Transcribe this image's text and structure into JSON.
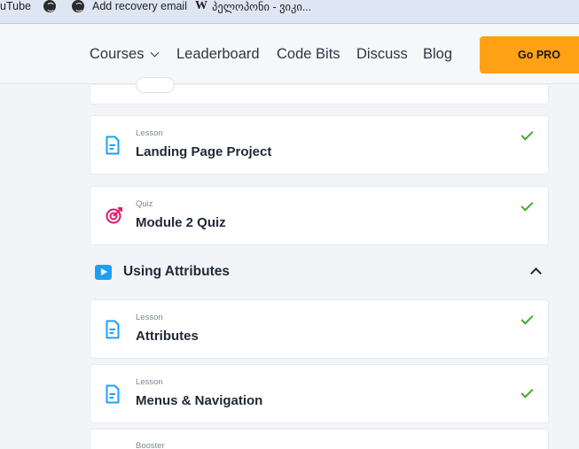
{
  "bookmarks": {
    "items": [
      {
        "label": "uTube"
      },
      {
        "label": ""
      },
      {
        "label": "Add recovery email"
      },
      {
        "label": "პელოპონი - ვიკი..."
      }
    ],
    "wiki_glyph": "W"
  },
  "nav": {
    "courses": "Courses",
    "leaderboard": "Leaderboard",
    "code_bits": "Code Bits",
    "discuss": "Discuss",
    "blog": "Blog",
    "go_pro": "Go PRO"
  },
  "cards": [
    {
      "type": "Lesson",
      "title": "Landing Page Project",
      "completed": true,
      "icon": "lesson-doc-icon"
    },
    {
      "type": "Quiz",
      "title": "Module 2 Quiz",
      "completed": true,
      "icon": "quiz-target-icon"
    }
  ],
  "section": {
    "title": "Using Attributes",
    "expanded": true
  },
  "section_cards": [
    {
      "type": "Lesson",
      "title": "Attributes",
      "completed": true,
      "icon": "lesson-doc-icon"
    },
    {
      "type": "Lesson",
      "title": "Menus & Navigation",
      "completed": true,
      "icon": "lesson-doc-icon"
    },
    {
      "type": "Booster",
      "title": "",
      "completed": false,
      "icon": ""
    }
  ],
  "colors": {
    "accent_blue": "#1ea0f2",
    "quiz_pink": "#e0196b",
    "check_green": "#3fae2a",
    "go_pro_orange": "#ffa114"
  }
}
